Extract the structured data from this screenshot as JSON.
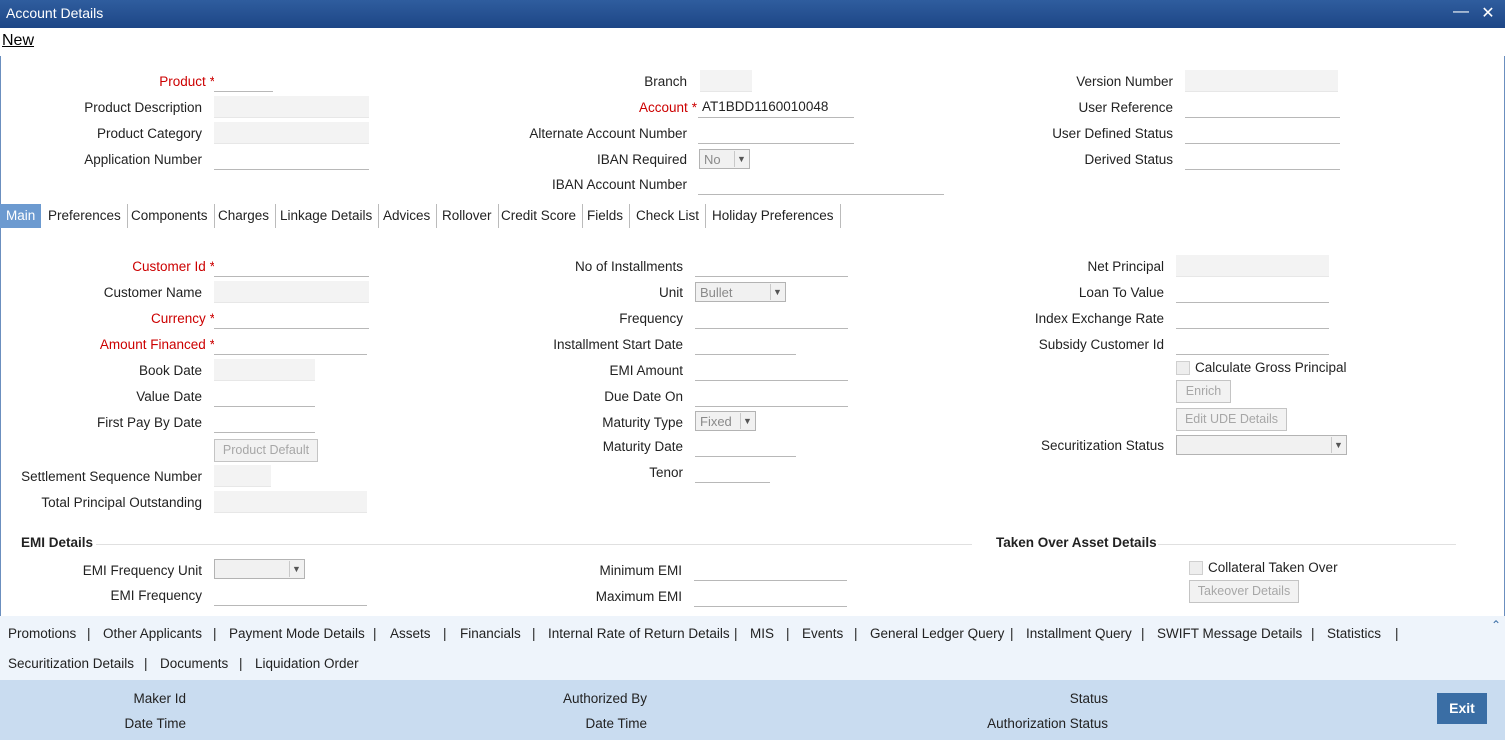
{
  "window": {
    "title": "Account Details"
  },
  "menu": {
    "new_label": "New"
  },
  "header": {
    "product_label": "Product",
    "product_value": "",
    "product_desc_label": "Product Description",
    "product_cat_label": "Product Category",
    "app_num_label": "Application Number",
    "branch_label": "Branch",
    "account_label": "Account",
    "account_value": "AT1BDD1160010048",
    "alt_acc_label": "Alternate Account Number",
    "iban_req_label": "IBAN Required",
    "iban_req_value": "No",
    "iban_acc_label": "IBAN Account Number",
    "version_label": "Version Number",
    "user_ref_label": "User Reference",
    "uds_label": "User Defined Status",
    "derived_label": "Derived Status"
  },
  "tabs": [
    "Main",
    "Preferences",
    "Components",
    "Charges",
    "Linkage Details",
    "Advices",
    "Rollover",
    "Credit Score",
    "Fields",
    "Check List",
    "Holiday Preferences"
  ],
  "main": {
    "customer_id_label": "Customer Id",
    "customer_name_label": "Customer Name",
    "currency_label": "Currency",
    "amount_label": "Amount Financed",
    "book_date_label": "Book Date",
    "value_date_label": "Value Date",
    "first_pay_label": "First Pay By Date",
    "product_default_btn": "Product Default",
    "settle_seq_label": "Settlement Sequence Number",
    "total_principal_label": "Total Principal Outstanding",
    "installments_label": "No of Installments",
    "unit_label": "Unit",
    "unit_value": "Bullet",
    "frequency_label": "Frequency",
    "inst_start_label": "Installment Start Date",
    "emi_amount_label": "EMI Amount",
    "due_date_label": "Due Date On",
    "maturity_type_label": "Maturity Type",
    "maturity_type_value": "Fixed",
    "maturity_date_label": "Maturity Date",
    "tenor_label": "Tenor",
    "net_principal_label": "Net Principal",
    "ltv_label": "Loan To Value",
    "index_rate_label": "Index Exchange Rate",
    "subsidy_label": "Subsidy Customer Id",
    "calc_gross_label": "Calculate Gross Principal",
    "enrich_btn": "Enrich",
    "edit_ude_btn": "Edit UDE Details",
    "securitization_label": "Securitization Status"
  },
  "emi": {
    "section_title": "EMI Details",
    "freq_unit_label": "EMI Frequency Unit",
    "frequency_label": "EMI Frequency",
    "min_label": "Minimum EMI",
    "max_label": "Maximum EMI"
  },
  "takeover": {
    "section_title": "Taken Over Asset Details",
    "collateral_label": "Collateral Taken Over",
    "details_btn": "Takeover Details"
  },
  "sublinks_row1": [
    "Promotions",
    "Other Applicants",
    "Payment Mode Details",
    "Assets",
    "Financials",
    "Internal Rate of Return Details",
    "MIS",
    "Events",
    "General Ledger Query",
    "Installment Query",
    "SWIFT Message Details",
    "Statistics"
  ],
  "sublinks_row2": [
    "Securitization Details",
    "Documents",
    "Liquidation Order"
  ],
  "footer": {
    "maker_label": "Maker Id",
    "maker_dt_label": "Date Time",
    "auth_label": "Authorized By",
    "auth_dt_label": "Date Time",
    "status_label": "Status",
    "auth_status_label": "Authorization Status",
    "exit_label": "Exit"
  }
}
